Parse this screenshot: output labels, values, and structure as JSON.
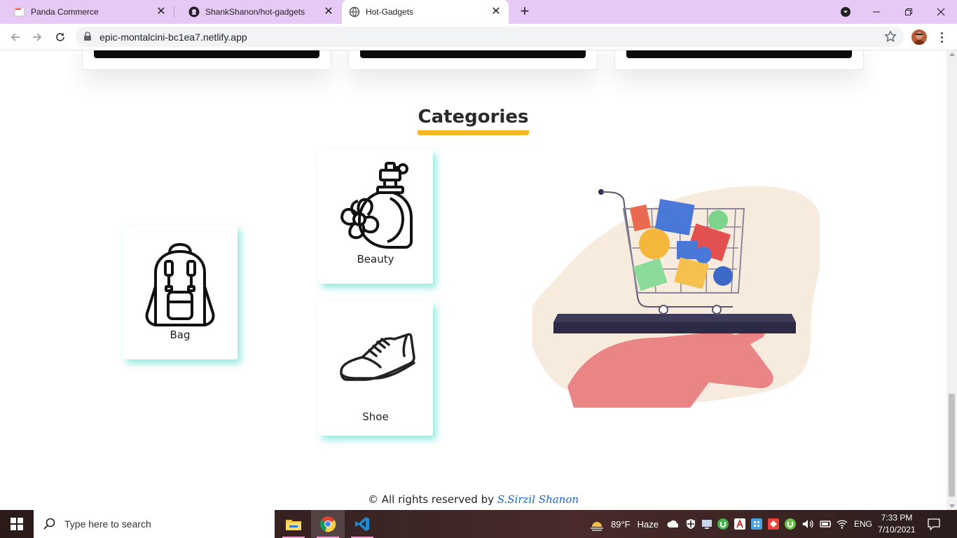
{
  "browser": {
    "tabs": [
      {
        "title": "Panda Commerce",
        "active": false
      },
      {
        "title": "ShankShanon/hot-gadgets",
        "active": false
      },
      {
        "title": "Hot-Gadgets",
        "active": true
      }
    ],
    "url": "epic-montalcini-bc1ea7.netlify.app"
  },
  "page": {
    "categories_heading": "Categories",
    "categories": [
      {
        "label": "Bag",
        "icon": "backpack-icon"
      },
      {
        "label": "Beauty",
        "icon": "perfume-icon"
      },
      {
        "label": "Shoe",
        "icon": "shoe-icon"
      }
    ],
    "footer": {
      "text": "© All rights reserved by ",
      "author": "S.Sirzil Shanon"
    }
  },
  "taskbar": {
    "search_placeholder": "Type here to search",
    "weather_temp": "89°F",
    "weather_desc": "Haze",
    "language": "ENG",
    "time": "7:33 PM",
    "date": "7/10/2021"
  },
  "colors": {
    "tabbar": "#e6c9f5",
    "heading_underline": "#f6b625",
    "card_shadow": "#40d7c7",
    "footer_author": "#1565d8"
  }
}
